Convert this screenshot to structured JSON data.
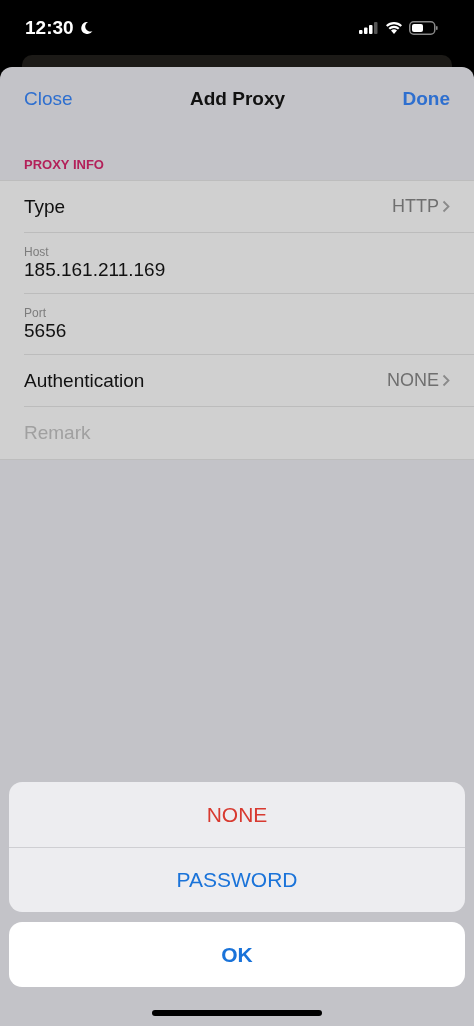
{
  "status_bar": {
    "time": "12:30"
  },
  "nav": {
    "left": "Close",
    "title": "Add Proxy",
    "right": "Done"
  },
  "section": {
    "header": "PROXY INFO",
    "rows": [
      {
        "kind": "disclosure",
        "label": "Type",
        "value": "HTTP"
      },
      {
        "kind": "field",
        "label": "Host",
        "value": "185.161.211.169"
      },
      {
        "kind": "field",
        "label": "Port",
        "value": "5656"
      },
      {
        "kind": "disclosure",
        "label": "Authentication",
        "value": "NONE"
      },
      {
        "kind": "empty",
        "placeholder": "Remark"
      }
    ]
  },
  "action_sheet": {
    "options": [
      {
        "label": "NONE",
        "kind": "destructive"
      },
      {
        "label": "PASSWORD",
        "kind": "default"
      }
    ],
    "cancel": "OK"
  }
}
